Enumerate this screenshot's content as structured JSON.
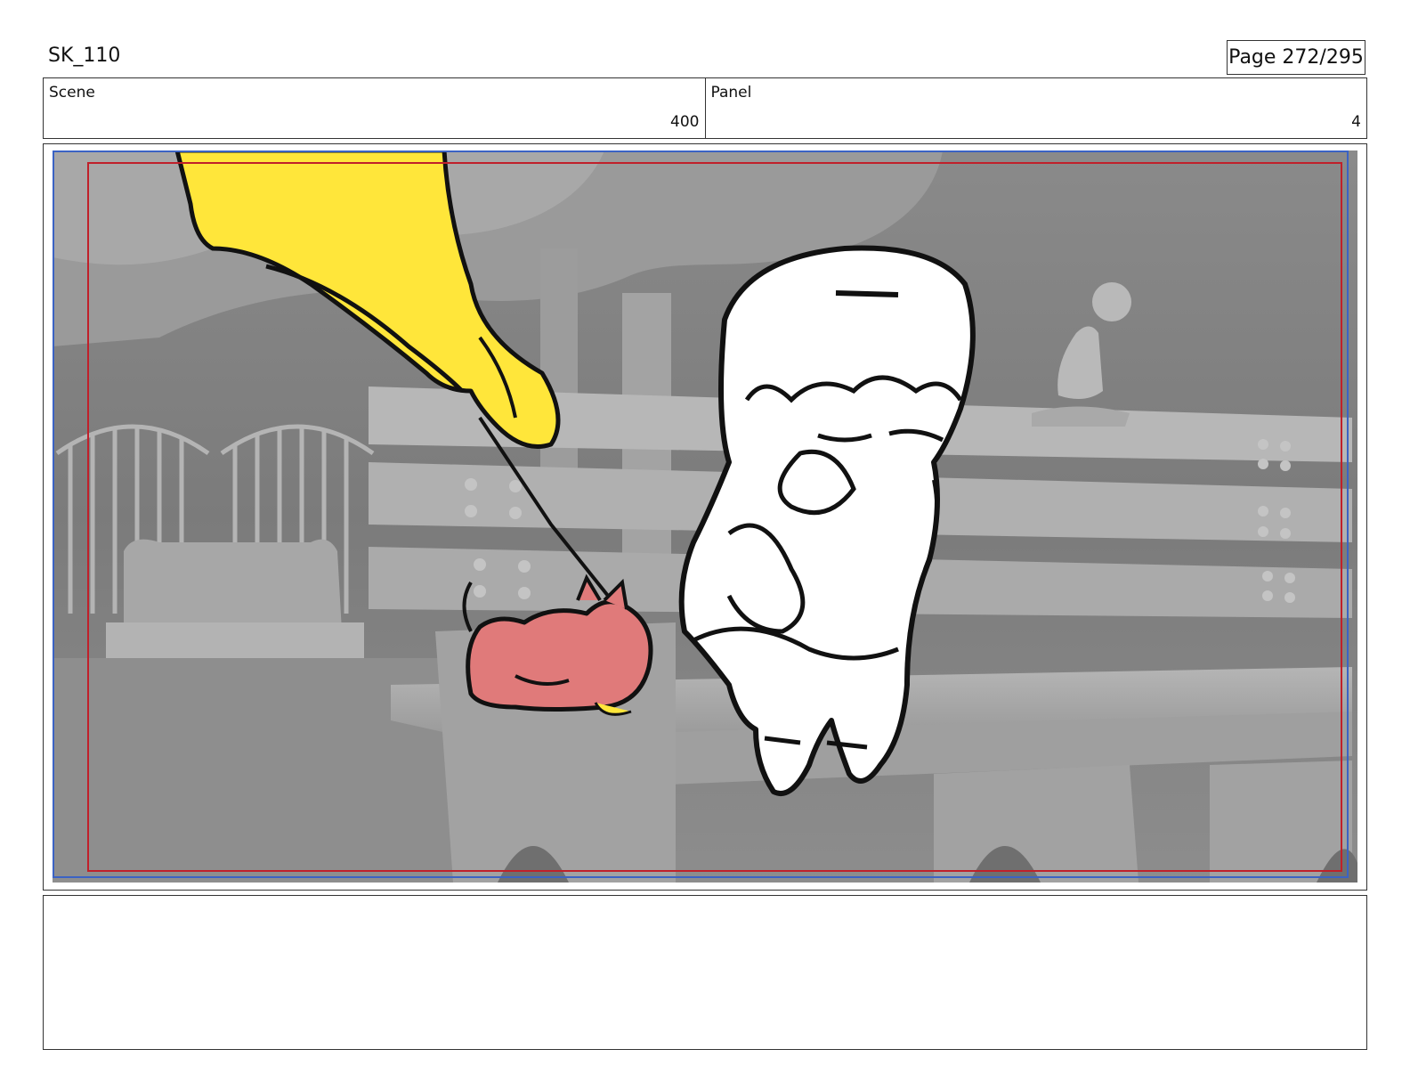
{
  "header": {
    "sequence": "SK_110",
    "page": "Page 272/295"
  },
  "info": {
    "scene_label": "Scene",
    "scene_value": "400",
    "panel_label": "Panel",
    "panel_value": "4"
  },
  "panel": {
    "description": ""
  },
  "notes": {
    "text": ""
  },
  "colors": {
    "safe_frame": "#c0202a",
    "camera_frame": "#3b63c4",
    "yellow_character": "#ffe63a",
    "pink_pet": "#e07a7a"
  }
}
